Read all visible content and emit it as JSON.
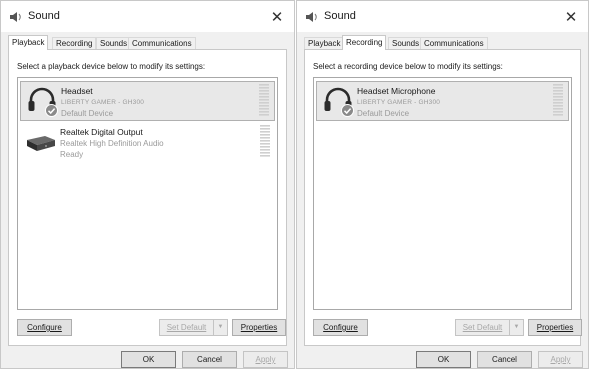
{
  "windows": [
    {
      "title": "Sound",
      "close_glyph": "✕",
      "tabs": [
        "Playback",
        "Recording",
        "Sounds",
        "Communications"
      ],
      "active_tab": "Playback",
      "instructions": "Select a playback device below to modify its settings:",
      "devices": [
        {
          "name": "Headset",
          "sub": "LIBERTY GAMER - GH300",
          "status": "Default Device",
          "icon": "headset-icon",
          "default": true,
          "selected": true
        },
        {
          "name": "Realtek Digital Output",
          "sub": "Realtek High Definition Audio",
          "status": "Ready",
          "icon": "digital-output-icon",
          "default": false,
          "selected": false
        }
      ],
      "buttons": {
        "configure": "Configure",
        "set_default": "Set Default",
        "properties": "Properties",
        "ok": "OK",
        "cancel": "Cancel",
        "apply": "Apply"
      }
    },
    {
      "title": "Sound",
      "close_glyph": "✕",
      "tabs": [
        "Playback",
        "Recording",
        "Sounds",
        "Communications"
      ],
      "active_tab": "Recording",
      "instructions": "Select a recording device below to modify its settings:",
      "devices": [
        {
          "name": "Headset Microphone",
          "sub": "LIBERTY GAMER - GH300",
          "status": "Default Device",
          "icon": "headset-icon",
          "default": true,
          "selected": true
        }
      ],
      "buttons": {
        "configure": "Configure",
        "set_default": "Set Default",
        "properties": "Properties",
        "ok": "OK",
        "cancel": "Cancel",
        "apply": "Apply"
      }
    }
  ],
  "icons": {
    "dropdown": "▼",
    "check": "✓"
  }
}
